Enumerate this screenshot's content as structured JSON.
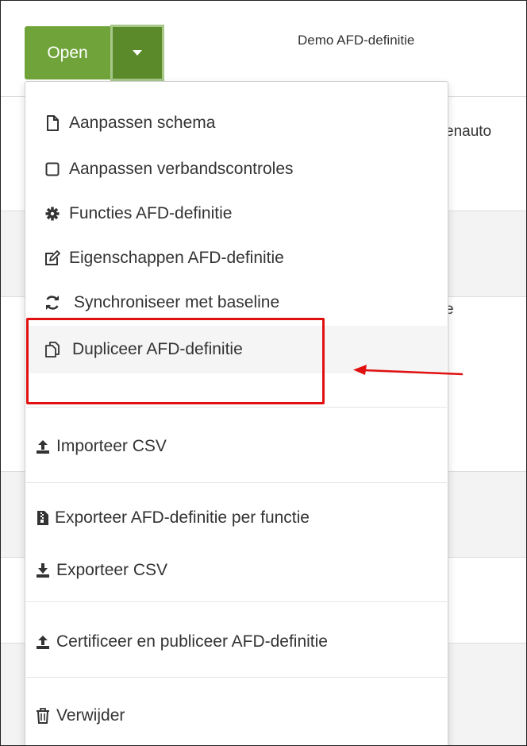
{
  "header": {
    "open_label": "Open",
    "title": "Demo AFD-definitie"
  },
  "background": {
    "row1_text": "enauto",
    "row2_text": "e"
  },
  "menu": {
    "items": [
      {
        "label": "Aanpassen schema",
        "icon": "file-icon"
      },
      {
        "label": "Aanpassen verbandscontroles",
        "icon": "square-icon"
      },
      {
        "label": "Functies AFD-definitie",
        "icon": "gear-icon"
      },
      {
        "label": "Eigenschappen AFD-definitie",
        "icon": "edit-icon"
      },
      {
        "label": "Synchroniseer met baseline",
        "icon": "sync-icon"
      },
      {
        "label": "Dupliceer AFD-definitie",
        "icon": "copy-icon"
      },
      {
        "label": "Importeer CSV",
        "icon": "upload-icon"
      },
      {
        "label": "Exporteer AFD-definitie per functie",
        "icon": "zip-file-icon"
      },
      {
        "label": "Exporteer CSV",
        "icon": "download-icon"
      },
      {
        "label": "Certificeer en publiceer AFD-definitie",
        "icon": "upload-icon"
      },
      {
        "label": "Verwijder",
        "icon": "trash-icon"
      }
    ]
  },
  "colors": {
    "button_green": "#70a33a",
    "caret_green": "#5b8a2b",
    "highlight_red": "#e01010"
  }
}
